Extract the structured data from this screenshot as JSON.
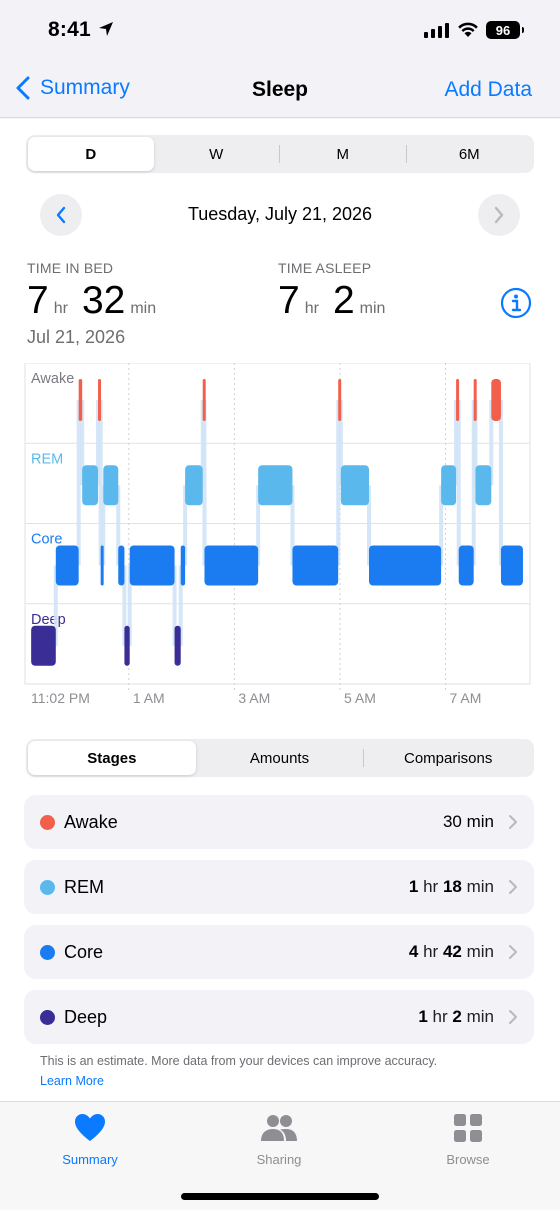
{
  "status": {
    "time": "8:41",
    "battery": "96"
  },
  "nav": {
    "back_label": "Summary",
    "title": "Sleep",
    "action_label": "Add Data"
  },
  "period_tabs": [
    "D",
    "W",
    "M",
    "6M"
  ],
  "date": {
    "label": "Tuesday, July 21, 2026"
  },
  "time_in_bed": {
    "label": "TIME IN BED",
    "hours": "7",
    "hours_unit": "hr",
    "minutes": "32",
    "minutes_unit": "min",
    "date": "Jul 21, 2026"
  },
  "time_asleep": {
    "label": "TIME ASLEEP",
    "hours": "7",
    "hours_unit": "hr",
    "minutes": "2",
    "minutes_unit": "min"
  },
  "chart_data": {
    "type": "timeline",
    "stages": [
      "Awake",
      "REM",
      "Core",
      "Deep"
    ],
    "x_ticks": [
      "11:02 PM",
      "1 AM",
      "3 AM",
      "5 AM",
      "7 AM"
    ],
    "x_range": [
      "23:02",
      "08:36"
    ],
    "segments": [
      {
        "stage": "Deep",
        "start": "23:09",
        "end": "23:37"
      },
      {
        "stage": "Core",
        "start": "23:37",
        "end": "00:03"
      },
      {
        "stage": "Awake",
        "start": "00:03",
        "end": "00:07"
      },
      {
        "stage": "REM",
        "start": "00:07",
        "end": "00:25"
      },
      {
        "stage": "Awake",
        "start": "00:25",
        "end": "00:28"
      },
      {
        "stage": "Core",
        "start": "00:28",
        "end": "00:31"
      },
      {
        "stage": "REM",
        "start": "00:31",
        "end": "00:48"
      },
      {
        "stage": "Core",
        "start": "00:48",
        "end": "00:55"
      },
      {
        "stage": "Deep",
        "start": "00:55",
        "end": "01:01"
      },
      {
        "stage": "Core",
        "start": "01:01",
        "end": "01:52"
      },
      {
        "stage": "Deep",
        "start": "01:52",
        "end": "01:59"
      },
      {
        "stage": "Core",
        "start": "01:59",
        "end": "02:04"
      },
      {
        "stage": "REM",
        "start": "02:04",
        "end": "02:24"
      },
      {
        "stage": "Awake",
        "start": "02:24",
        "end": "02:26"
      },
      {
        "stage": "Core",
        "start": "02:26",
        "end": "03:27"
      },
      {
        "stage": "REM",
        "start": "03:27",
        "end": "04:06"
      },
      {
        "stage": "Core",
        "start": "04:06",
        "end": "04:58"
      },
      {
        "stage": "Awake",
        "start": "04:58",
        "end": "05:01"
      },
      {
        "stage": "REM",
        "start": "05:01",
        "end": "05:33"
      },
      {
        "stage": "Core",
        "start": "05:33",
        "end": "06:55"
      },
      {
        "stage": "REM",
        "start": "06:55",
        "end": "07:12"
      },
      {
        "stage": "Awake",
        "start": "07:12",
        "end": "07:15"
      },
      {
        "stage": "Core",
        "start": "07:15",
        "end": "07:32"
      },
      {
        "stage": "Awake",
        "start": "07:32",
        "end": "07:34"
      },
      {
        "stage": "REM",
        "start": "07:34",
        "end": "07:52"
      },
      {
        "stage": "Awake",
        "start": "07:52",
        "end": "08:03"
      },
      {
        "stage": "Core",
        "start": "08:03",
        "end": "08:28"
      }
    ],
    "colors": {
      "Awake": "#f2604c",
      "REM": "#5ab8ec",
      "Core": "#1a7cf0",
      "Deep": "#3a2d95"
    }
  },
  "view_tabs": [
    "Stages",
    "Amounts",
    "Comparisons"
  ],
  "stages_list": [
    {
      "name": "Awake",
      "bold": "30",
      "unit": "min",
      "bold2": "",
      "unit2": "",
      "color": "#f2604c"
    },
    {
      "name": "REM",
      "bold": "1",
      "unit": "hr",
      "bold2": "18",
      "unit2": "min",
      "color": "#5ab8ec"
    },
    {
      "name": "Core",
      "bold": "4",
      "unit": "hr",
      "bold2": "42",
      "unit2": "min",
      "color": "#1a7cf0"
    },
    {
      "name": "Deep",
      "bold": "1",
      "unit": "hr",
      "bold2": "2",
      "unit2": "min",
      "color": "#3a2d95"
    }
  ],
  "footnote": {
    "text": "This is an estimate. More data from your devices can improve accuracy.",
    "link": "Learn More"
  },
  "tabbar": [
    {
      "label": "Summary",
      "icon": "heart-icon",
      "active": true
    },
    {
      "label": "Sharing",
      "icon": "people-icon",
      "active": false
    },
    {
      "label": "Browse",
      "icon": "grid-icon",
      "active": false
    }
  ]
}
